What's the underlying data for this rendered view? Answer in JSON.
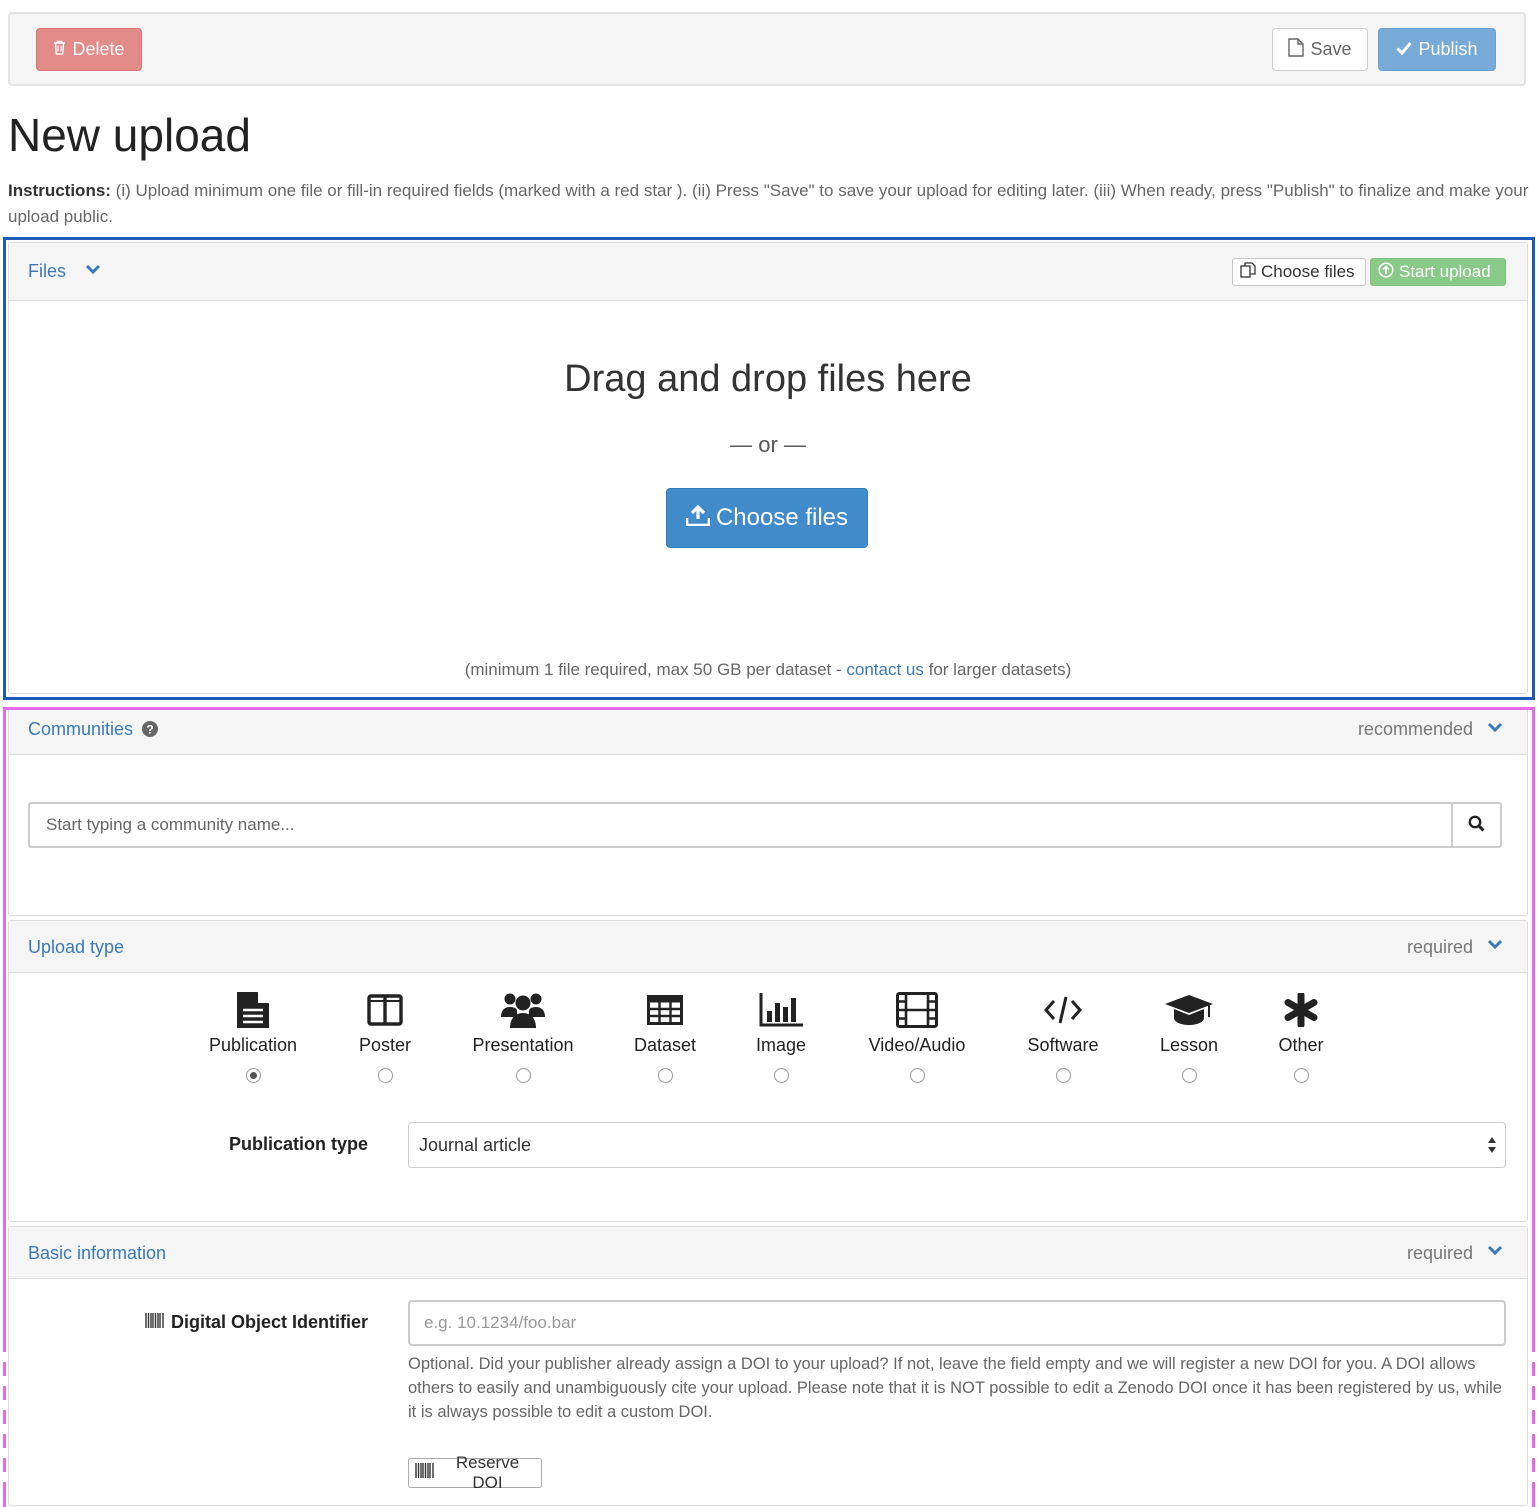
{
  "toolbar": {
    "delete_label": "Delete",
    "save_label": "Save",
    "publish_label": "Publish"
  },
  "page": {
    "title": "New upload",
    "instructions_bold": "Instructions:",
    "instructions_text": " (i) Upload minimum one file or fill-in required fields (marked with a red star ). (ii) Press \"Save\" to save your upload for editing later. (iii) When ready, press \"Publish\" to finalize and make your upload public."
  },
  "files": {
    "title": "Files",
    "choose_small_label": "Choose files",
    "start_upload_label": "Start upload",
    "drop_title": "Drag and drop files here",
    "or_text": "— or —",
    "choose_big_label": "Choose files",
    "note_before": "(minimum 1 file required, max 50 GB per dataset - ",
    "note_link": "contact us",
    "note_after": " for larger datasets)"
  },
  "communities": {
    "title": "Communities",
    "hint": "recommended",
    "placeholder": "Start typing a community name..."
  },
  "upload_type": {
    "title": "Upload type",
    "hint": "required",
    "options": [
      {
        "label": "Publication",
        "icon": "file-text-icon",
        "selected": true
      },
      {
        "label": "Poster",
        "icon": "columns-icon",
        "selected": false
      },
      {
        "label": "Presentation",
        "icon": "users-icon",
        "selected": false
      },
      {
        "label": "Dataset",
        "icon": "table-icon",
        "selected": false
      },
      {
        "label": "Image",
        "icon": "bar-chart-icon",
        "selected": false
      },
      {
        "label": "Video/Audio",
        "icon": "film-icon",
        "selected": false
      },
      {
        "label": "Software",
        "icon": "code-icon",
        "selected": false
      },
      {
        "label": "Lesson",
        "icon": "graduation-cap-icon",
        "selected": false
      },
      {
        "label": "Other",
        "icon": "asterisk-icon",
        "selected": false
      }
    ],
    "publication_type_label": "Publication type",
    "publication_type_value": "Journal article"
  },
  "basic_info": {
    "title": "Basic information",
    "hint": "required",
    "doi_label": "Digital Object Identifier",
    "doi_placeholder": "e.g. 10.1234/foo.bar",
    "doi_help": "Optional. Did your publisher already assign a DOI to your upload? If not, leave the field empty and we will register a new DOI for you. A DOI allows others to easily and unambiguously cite your upload. Please note that it is NOT possible to edit a Zenodo DOI once it has been registered by us, while it is always possible to edit a custom DOI.",
    "reserve_doi_label": "Reserve DOI"
  },
  "colors": {
    "link": "#3a7ab8",
    "primary": "#428bca",
    "danger": "#d9534f",
    "success": "#5cb85c",
    "files_outline": "#1e5bb8",
    "metadata_outline": "#e86ae8"
  }
}
